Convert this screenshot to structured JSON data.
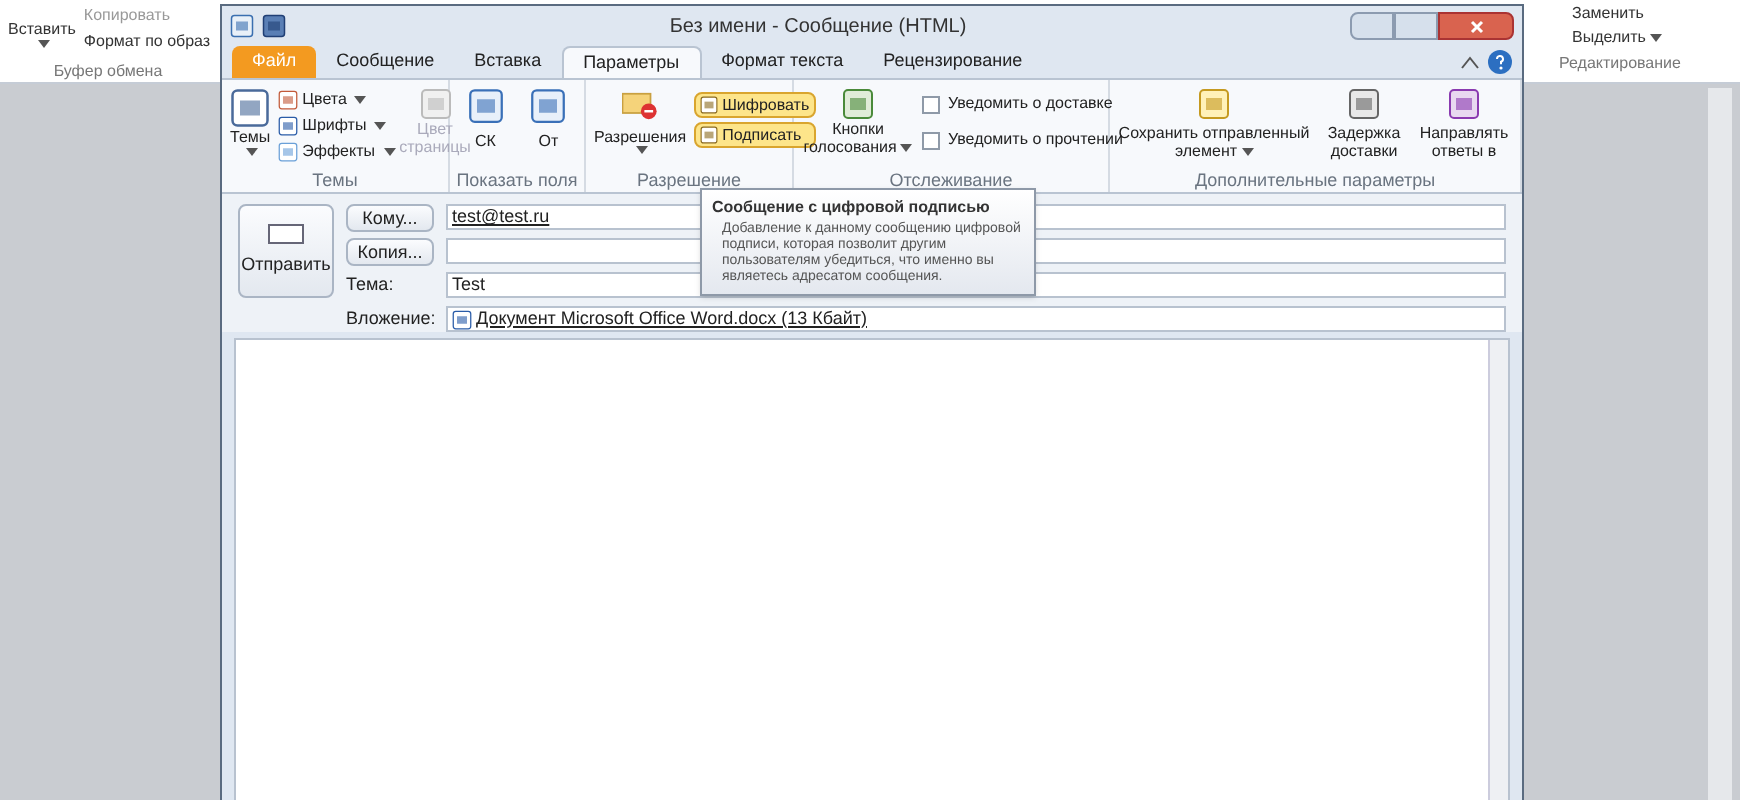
{
  "background_app": {
    "clipboard": {
      "paste": "Вставить",
      "copy": "Копировать",
      "format_painter": "Формат по образ",
      "group": "Буфер обмена"
    },
    "editing": {
      "replace": "Заменить",
      "select": "Выделить",
      "group": "Редактирование"
    }
  },
  "window": {
    "title": "Без имени - Сообщение (HTML)"
  },
  "tabs": [
    {
      "label": "Файл",
      "kind": "file",
      "selected": false
    },
    {
      "label": "Сообщение",
      "kind": "tab",
      "selected": false
    },
    {
      "label": "Вставка",
      "kind": "tab",
      "selected": false
    },
    {
      "label": "Параметры",
      "kind": "tab",
      "selected": true
    },
    {
      "label": "Формат текста",
      "kind": "tab",
      "selected": false
    },
    {
      "label": "Рецензирование",
      "kind": "tab",
      "selected": false
    }
  ],
  "ribbon": {
    "themes": {
      "label": "Темы",
      "themes_button": "Темы",
      "colors": "Цвета",
      "fonts": "Шрифты",
      "effects": "Эффекты",
      "page_color": {
        "label": "Цвет страницы",
        "disabled": true
      }
    },
    "fields": {
      "label": "Показать поля",
      "buttons": [
        "СК",
        "От"
      ]
    },
    "permission": {
      "label": "Разрешение",
      "permissions": "Разрешения",
      "toggles": [
        {
          "label": "Шифровать",
          "on": true
        },
        {
          "label": "Подписать",
          "on": true
        }
      ]
    },
    "tracking": {
      "label": "Отслеживание",
      "voting": "Кнопки голосования",
      "checks": [
        {
          "label": "Уведомить о доставке",
          "checked": false
        },
        {
          "label": "Уведомить о прочтении",
          "checked": false
        }
      ]
    },
    "more": {
      "label": "Дополнительные параметры",
      "buttons": [
        "Сохранить отправленный элемент",
        "Задержка доставки",
        "Направлять ответы в"
      ]
    }
  },
  "message": {
    "send": "Отправить",
    "rows": [
      {
        "kind": "button",
        "label": "Кому...",
        "value": "test@test.ru"
      },
      {
        "kind": "button",
        "label": "Копия..."
      },
      {
        "kind": "label",
        "label": "Тема:",
        "value": "Test"
      },
      {
        "kind": "attachment",
        "label": "Вложение:",
        "value": "Документ Microsoft Office Word.docx (13 Кбайт)"
      }
    ]
  },
  "tooltip": {
    "title": "Сообщение с цифровой подписью",
    "text": "Добавление к данному сообщению цифровой подписи, которая позволит другим пользователям убедиться, что именно вы являетесь адресатом сообщения."
  }
}
